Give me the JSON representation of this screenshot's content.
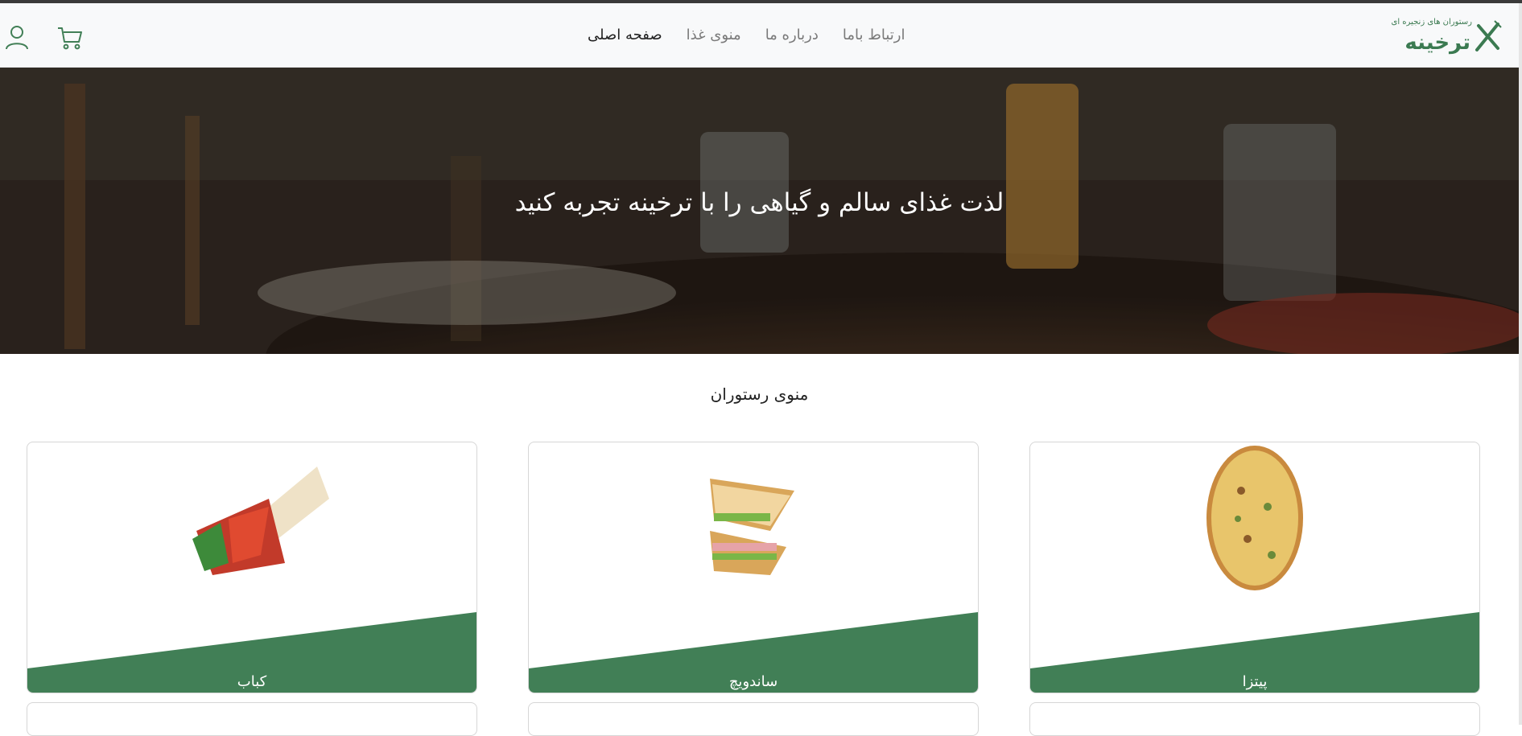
{
  "header": {
    "logo_text": "ترخینه",
    "logo_tagline": "رستوران های زنجیره ای",
    "nav": [
      {
        "label": "صفحه اصلی",
        "active": true
      },
      {
        "label": "منوی غذا",
        "active": false
      },
      {
        "label": "درباره ما",
        "active": false
      },
      {
        "label": "ارتباط باما",
        "active": false
      }
    ],
    "icons": [
      "user-icon",
      "cart-icon"
    ],
    "accent_color": "#417F56"
  },
  "hero": {
    "title": "لذت غذای سالم و گیاهی را با ترخینه تجربه کنید"
  },
  "menu": {
    "title": "منوی رستوران",
    "cards": [
      {
        "label": "پیتزا",
        "image": "pizza-image"
      },
      {
        "label": "ساندویچ",
        "image": "sandwich-image"
      },
      {
        "label": "کباب",
        "image": "wrap-image"
      }
    ]
  }
}
